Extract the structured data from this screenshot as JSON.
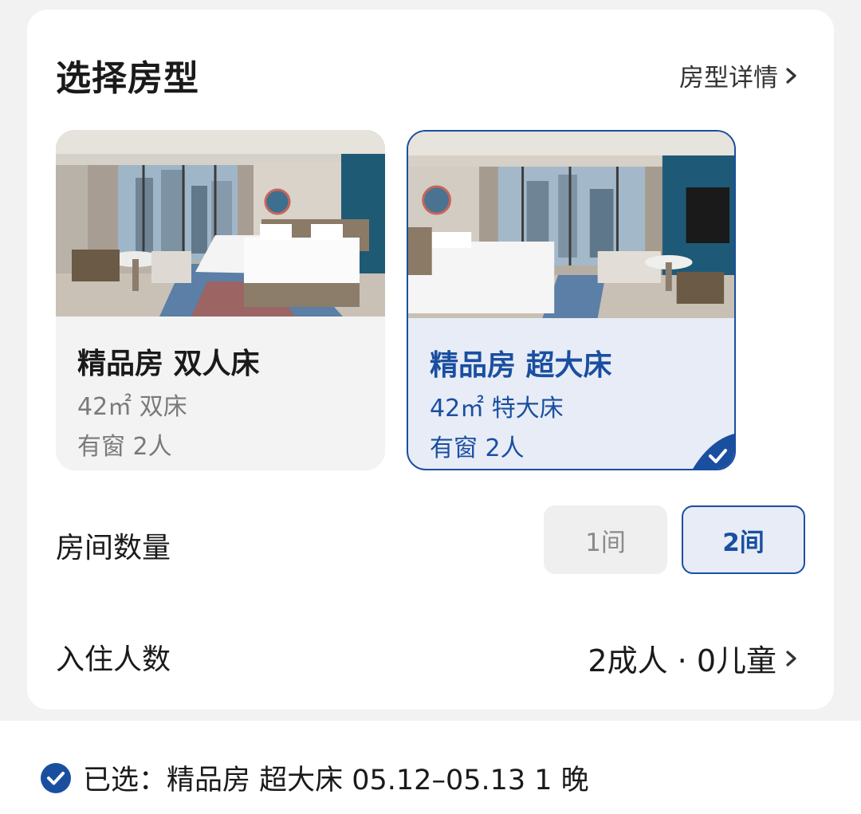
{
  "header": {
    "title": "选择房型",
    "detail_link": "房型详情"
  },
  "rooms": [
    {
      "name": "精品房 双人床",
      "spec": "42㎡ 双床",
      "features": "有窗 2人",
      "selected": false,
      "photo_icon": "hotel-room-twin-photo"
    },
    {
      "name": "精品房 超大床",
      "spec": "42㎡ 特大床",
      "features": "有窗 2人",
      "selected": true,
      "photo_icon": "hotel-room-king-photo"
    }
  ],
  "room_count": {
    "label": "房间数量",
    "options": [
      "1间",
      "2间"
    ],
    "selected": "2间"
  },
  "guests": {
    "label": "入住人数",
    "value": "2成人 · 0儿童"
  },
  "summary": {
    "text": "已选：精品房 超大床 05.12–05.13 1 晚"
  },
  "colors": {
    "accent": "#1a4fa0",
    "selected_bg": "#e7ecf6",
    "muted_text": "#7a7a7a",
    "card_bg": "#ffffff",
    "page_bg": "#f2f2f2"
  }
}
